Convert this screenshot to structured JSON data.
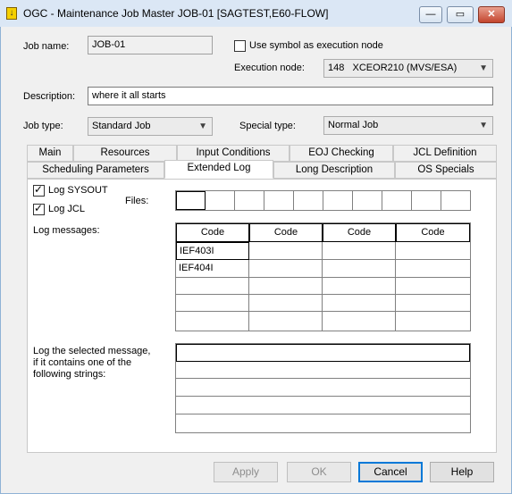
{
  "window": {
    "title": "OGC - Maintenance Job Master JOB-01 [SAGTEST,E60-FLOW]",
    "icon": "yellow-down-arrow-icon"
  },
  "form": {
    "job_name_label": "Job name:",
    "job_name_value": "JOB-01",
    "use_symbol_label": "Use symbol as execution node",
    "use_symbol_checked": false,
    "execution_node_label": "Execution node:",
    "execution_node_num": "148",
    "execution_node_value": "XCEOR210 (MVS/ESA)",
    "description_label": "Description:",
    "description_value": "where it all starts",
    "job_type_label": "Job type:",
    "job_type_value": "Standard Job",
    "special_type_label": "Special type:",
    "special_type_value": "Normal Job"
  },
  "tabs_row1": [
    "Main",
    "Resources",
    "Input Conditions",
    "EOJ Checking",
    "JCL Definition"
  ],
  "tabs_row2": [
    "Scheduling Parameters",
    "Extended Log",
    "Long Description",
    "OS Specials"
  ],
  "active_tab": "Extended Log",
  "extended_log": {
    "log_sysout_label": "Log SYSOUT",
    "log_sysout_checked": true,
    "log_jcl_label": "Log JCL",
    "log_jcl_checked": true,
    "files_label": "Files:",
    "log_messages_label": "Log messages:",
    "code_headers": [
      "Code",
      "Code",
      "Code",
      "Code"
    ],
    "codes": [
      "IEF403I",
      "IEF404I"
    ],
    "strings_label_1": "Log the selected message,",
    "strings_label_2": "if it contains one of the",
    "strings_label_3": "following strings:"
  },
  "buttons": {
    "apply": "Apply",
    "ok": "OK",
    "cancel": "Cancel",
    "help": "Help"
  },
  "colors": {
    "accent": "#0078d7",
    "title_bar": "#dbe7f5",
    "close": "#c3452e"
  }
}
